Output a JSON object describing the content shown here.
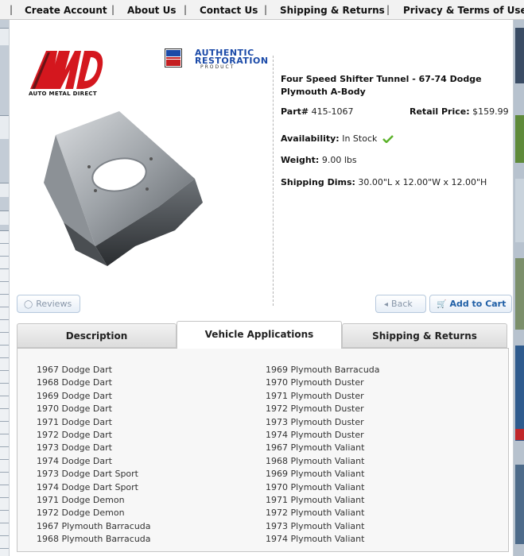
{
  "nav": {
    "items": [
      "Create Account",
      "About Us",
      "Contact Us",
      "Shipping & Returns",
      "Privacy & Terms of Use"
    ],
    "separator": "|"
  },
  "logos": {
    "amd_tagline": "AUTO METAL DIRECT",
    "authentic_line1": "AUTHENTIC",
    "authentic_line2": "RESTORATION",
    "authentic_line3": "PRODUCT"
  },
  "product": {
    "title": "Four Speed Shifter Tunnel - 67-74 Dodge Plymouth A-Body",
    "part_label": "Part#",
    "part_number": "415-1067",
    "price_label": "Retail Price:",
    "price": "$159.99",
    "availability_label": "Availability:",
    "availability": "In Stock",
    "weight_label": "Weight:",
    "weight": "9.00 lbs",
    "dims_label": "Shipping Dims:",
    "dims": "30.00\"L x 12.00\"W x 12.00\"H"
  },
  "buttons": {
    "reviews": "Reviews",
    "back": "Back",
    "add_to_cart": "Add to Cart"
  },
  "tabs": {
    "description": "Description",
    "vehicle_applications": "Vehicle Applications",
    "shipping_returns": "Shipping & Returns",
    "active": "Vehicle Applications"
  },
  "applications": {
    "left": [
      "1967 Dodge Dart",
      "1968 Dodge Dart",
      "1969 Dodge Dart",
      "1970 Dodge Dart",
      "1971 Dodge Dart",
      "1972 Dodge Dart",
      "1973 Dodge Dart",
      "1974 Dodge Dart",
      "1973 Dodge Dart Sport",
      "1974 Dodge Dart Sport",
      "1971 Dodge Demon",
      "1972 Dodge Demon",
      "1967 Plymouth Barracuda",
      "1968 Plymouth Barracuda"
    ],
    "right": [
      "1969 Plymouth Barracuda",
      "1970 Plymouth Duster",
      "1971 Plymouth Duster",
      "1972 Plymouth Duster",
      "1973 Plymouth Duster",
      "1974 Plymouth Duster",
      "1967 Plymouth Valiant",
      "1968 Plymouth Valiant",
      "1969 Plymouth Valiant",
      "1970 Plymouth Valiant",
      "1971 Plymouth Valiant",
      "1972 Plymouth Valiant",
      "1973 Plymouth Valiant",
      "1974 Plymouth Valiant"
    ]
  },
  "colors": {
    "accent_blue": "#1f5fa6",
    "logo_red": "#d4171e",
    "check_green": "#5cb22a"
  }
}
